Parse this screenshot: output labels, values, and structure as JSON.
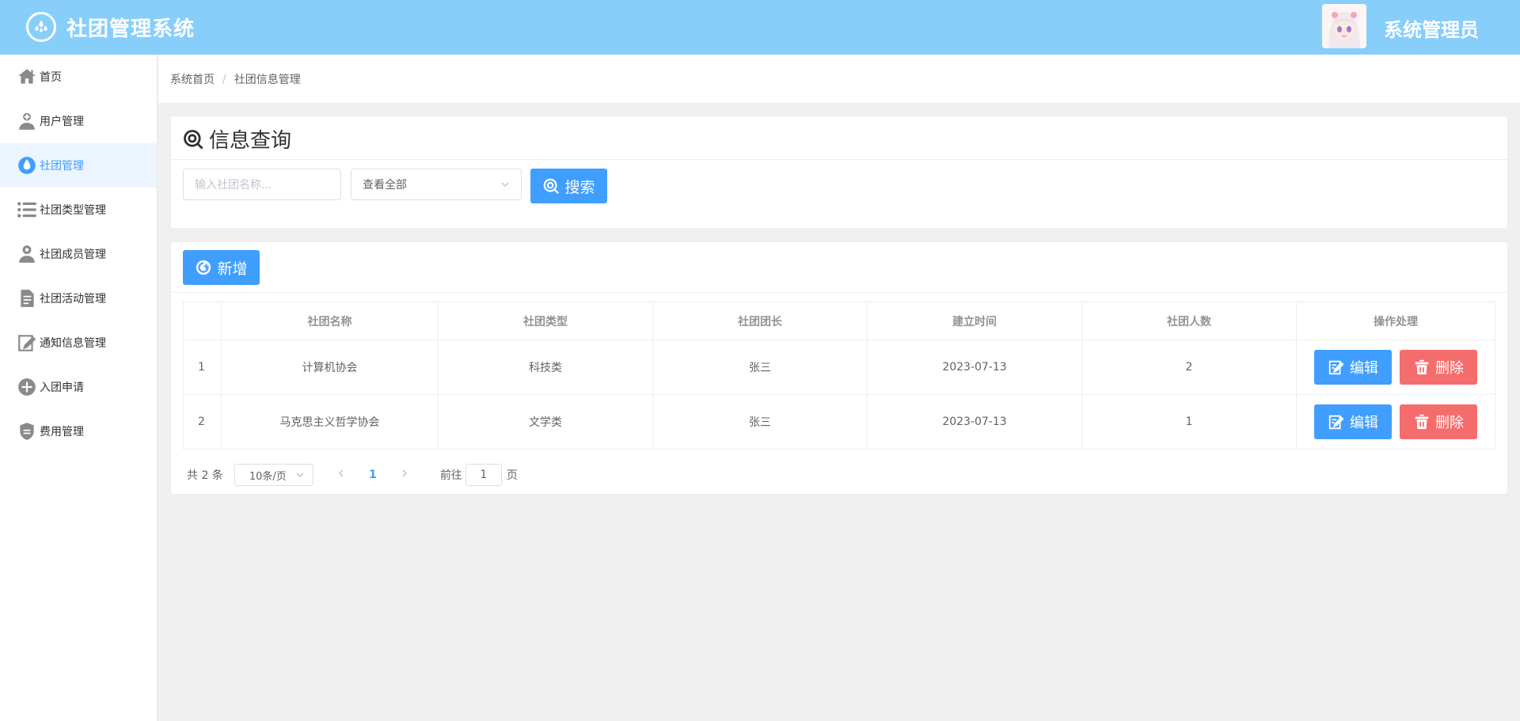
{
  "header": {
    "title": "社团管理系统",
    "user_name": "系统管理员",
    "logo_icon": "drops-logo-icon",
    "avatar_icon": "anime-avatar"
  },
  "sidebar": {
    "items": [
      {
        "label": "首页",
        "icon": "home-icon"
      },
      {
        "label": "用户管理",
        "icon": "user-add-icon"
      },
      {
        "label": "社团管理",
        "icon": "drop-icon",
        "active": true
      },
      {
        "label": "社团类型管理",
        "icon": "list-icon"
      },
      {
        "label": "社团成员管理",
        "icon": "member-icon"
      },
      {
        "label": "社团活动管理",
        "icon": "document-icon"
      },
      {
        "label": "通知信息管理",
        "icon": "edit-icon"
      },
      {
        "label": "入团申请",
        "icon": "plus-circle-icon"
      },
      {
        "label": "费用管理",
        "icon": "shield-icon"
      }
    ]
  },
  "breadcrumb": {
    "home": "系统首页",
    "separator": "/",
    "current": "社团信息管理"
  },
  "query": {
    "title": "信息查询",
    "name_placeholder": "输入社团名称...",
    "select_value": "查看全部",
    "search_label": "搜索"
  },
  "list": {
    "add_label": "新增",
    "columns": [
      "",
      "社团名称",
      "社团类型",
      "社团团长",
      "建立时间",
      "社团人数",
      "操作处理"
    ],
    "rows": [
      {
        "index": "1",
        "name": "计算机协会",
        "type": "科技类",
        "leader": "张三",
        "date": "2023-07-13",
        "count": "2"
      },
      {
        "index": "2",
        "name": "马克思主义哲学协会",
        "type": "文学类",
        "leader": "张三",
        "date": "2023-07-13",
        "count": "1"
      }
    ],
    "edit_label": "编辑",
    "delete_label": "删除"
  },
  "pager": {
    "total": "共 2 条",
    "page_size": "10条/页",
    "current_page": "1",
    "goto_label": "前往",
    "goto_value": "1",
    "unit": "页"
  },
  "colors": {
    "header_bg": "#87cefa",
    "primary": "#409eff",
    "danger": "#f56c6c",
    "active_bg": "#ecf5ff"
  }
}
